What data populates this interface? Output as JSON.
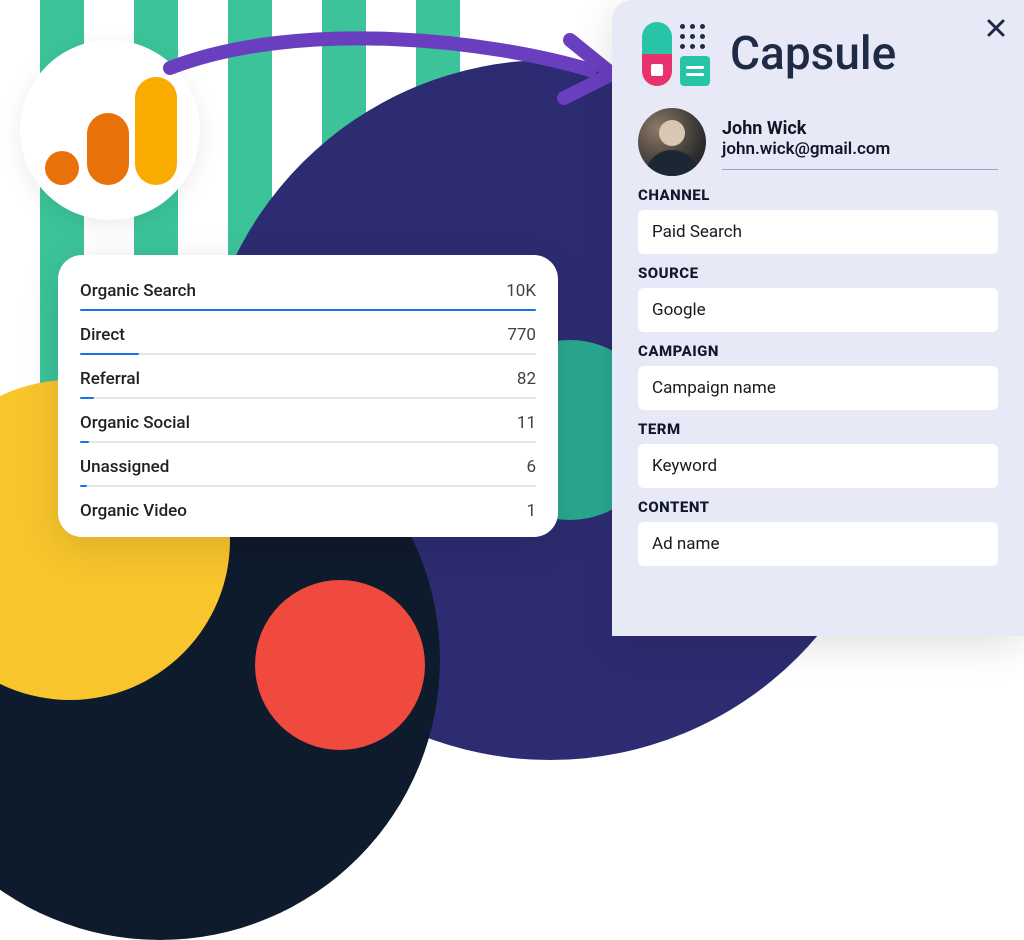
{
  "analytics": {
    "rows": [
      {
        "label": "Organic Search",
        "value": "10K",
        "pct": 100
      },
      {
        "label": "Direct",
        "value": "770",
        "pct": 13
      },
      {
        "label": "Referral",
        "value": "82",
        "pct": 3
      },
      {
        "label": "Organic Social",
        "value": "11",
        "pct": 2
      },
      {
        "label": "Unassigned",
        "value": "6",
        "pct": 1.5
      },
      {
        "label": "Organic Video",
        "value": "1",
        "pct": 1
      }
    ]
  },
  "capsule": {
    "brand": "Capsule",
    "contact": {
      "name": "John Wick",
      "email": "john.wick@gmail.com"
    },
    "fields": [
      {
        "label": "CHANNEL",
        "value": "Paid Search"
      },
      {
        "label": "SOURCE",
        "value": "Google"
      },
      {
        "label": "CAMPAIGN",
        "value": "Campaign name"
      },
      {
        "label": "TERM",
        "value": "Keyword"
      },
      {
        "label": "CONTENT",
        "value": "Ad name"
      }
    ]
  },
  "chart_data": {
    "type": "bar",
    "title": "",
    "categories": [
      "Organic Search",
      "Direct",
      "Referral",
      "Organic Social",
      "Unassigned",
      "Organic Video"
    ],
    "values": [
      10000,
      770,
      82,
      11,
      6,
      1
    ],
    "xlabel": "",
    "ylabel": "",
    "ylim": [
      0,
      10000
    ]
  }
}
